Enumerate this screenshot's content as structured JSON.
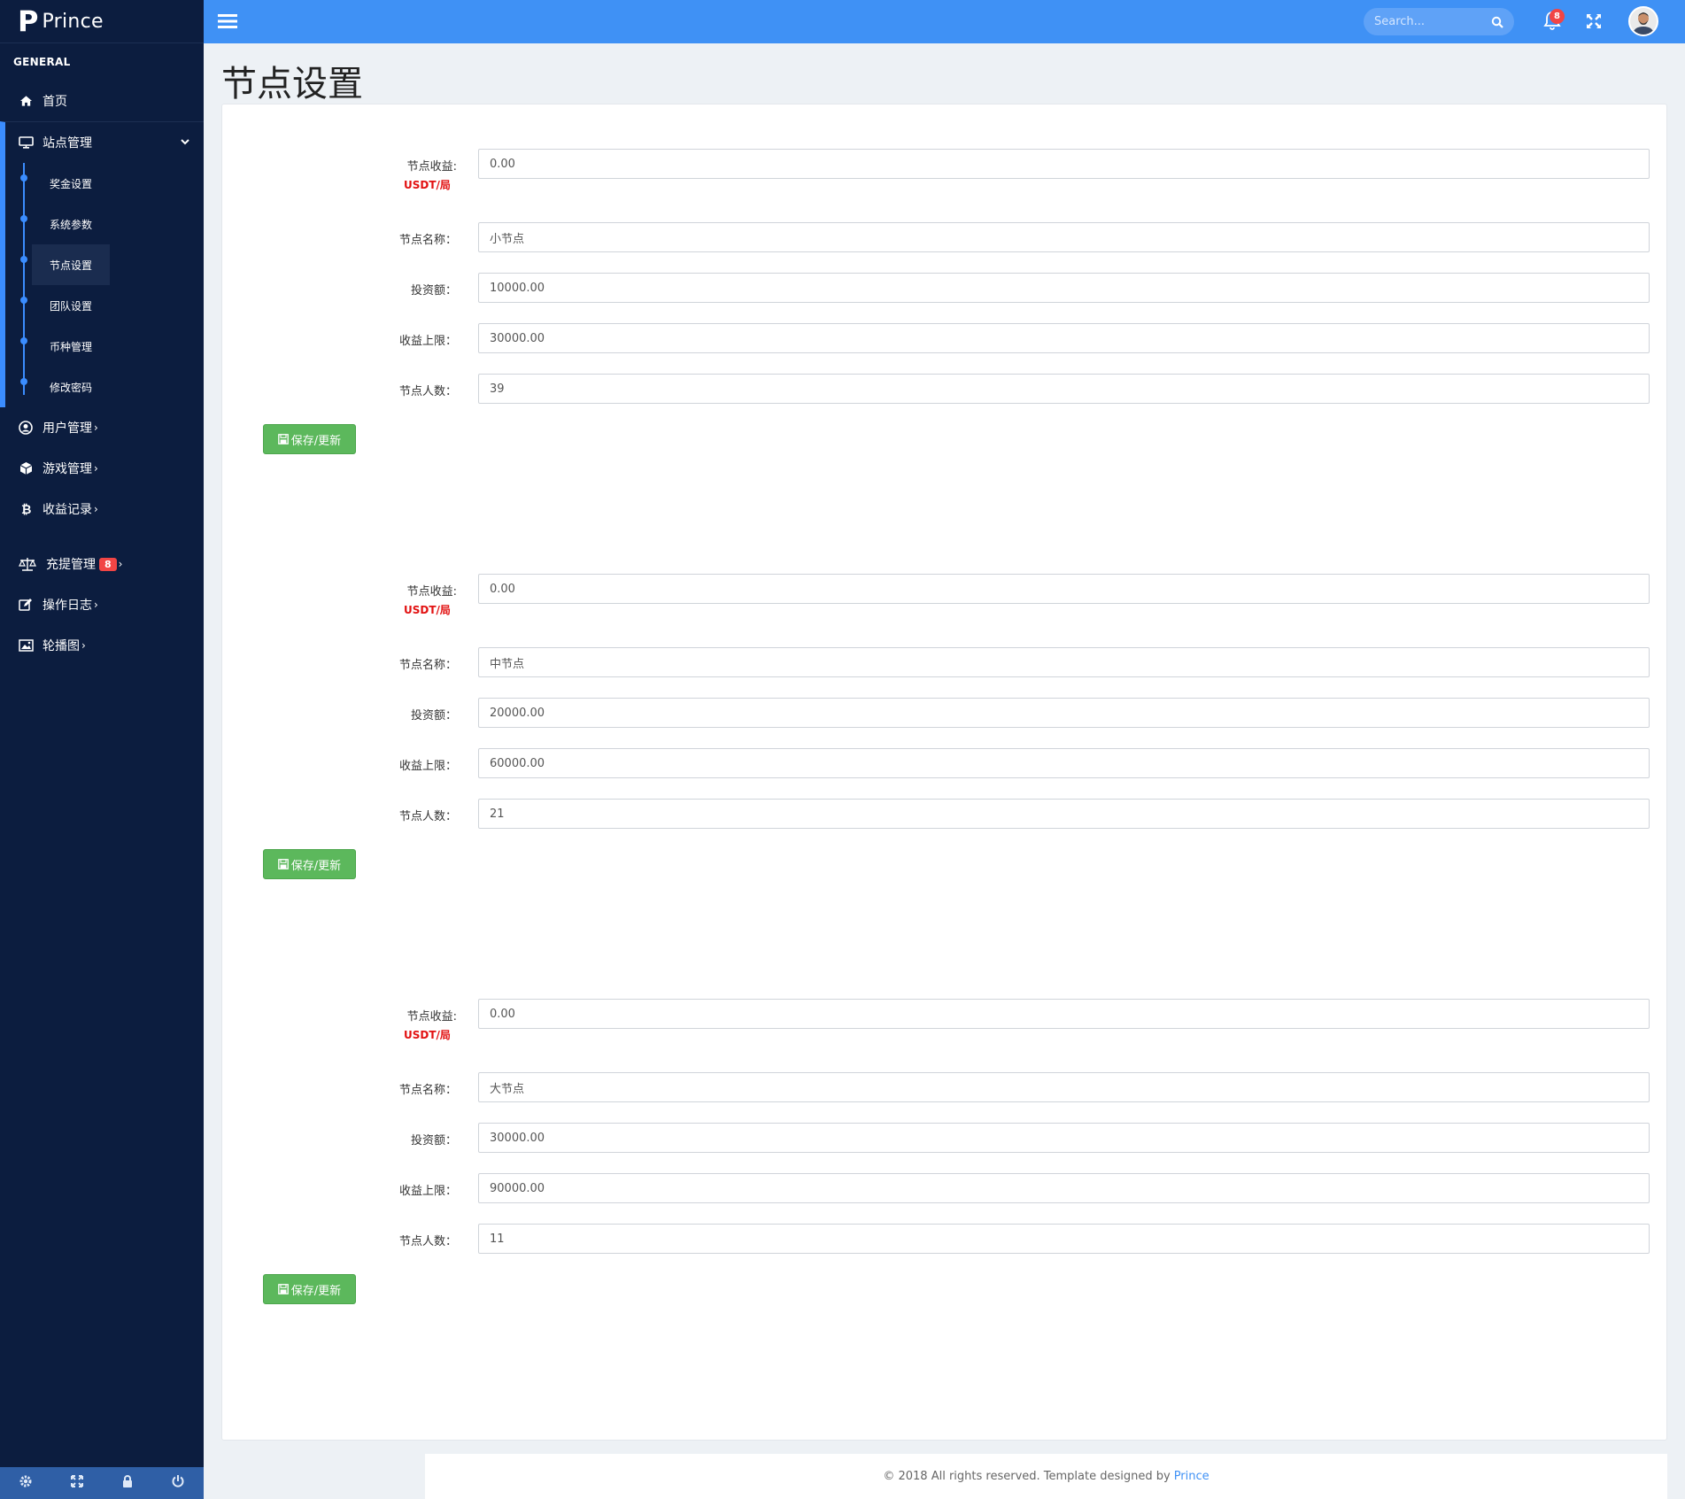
{
  "brand": {
    "mark": "P",
    "name": "Prince"
  },
  "sidebar": {
    "section_title": "GENERAL",
    "home": "首页",
    "site_group": "站点管理",
    "site_sub": [
      "奖金设置",
      "系统参数",
      "节点设置",
      "团队设置",
      "币种管理",
      "修改密码"
    ],
    "active_sub": "节点设置",
    "users": "用户管理",
    "games": "游戏管理",
    "income": "收益记录",
    "recharge": "充提管理",
    "recharge_badge": "8",
    "oplog": "操作日志",
    "banner": "轮播图",
    "arrow": "›"
  },
  "header": {
    "search_placeholder": "Search...",
    "notification_count": "8"
  },
  "page": {
    "title": "节点设置"
  },
  "labels": {
    "income": "节点收益:",
    "income_unit": "USDT/局",
    "name": "节点名称：",
    "invest": "投资额：",
    "limit": "收益上限：",
    "count": "节点人数：",
    "save": "保存/更新"
  },
  "nodes": [
    {
      "income": "0.00",
      "name": "小节点",
      "invest": "10000.00",
      "limit": "30000.00",
      "count": "39"
    },
    {
      "income": "0.00",
      "name": "中节点",
      "invest": "20000.00",
      "limit": "60000.00",
      "count": "21"
    },
    {
      "income": "0.00",
      "name": "大节点",
      "invest": "30000.00",
      "limit": "90000.00",
      "count": "11"
    }
  ],
  "footer": {
    "text": "© 2018 All rights reserved. Template designed by",
    "link": "Prince"
  },
  "colors": {
    "sidebar": "#0c1d3f",
    "header": "#3f91f5",
    "accent": "#3b8dff",
    "save_button": "#5cb85c",
    "badge": "#f14545"
  }
}
